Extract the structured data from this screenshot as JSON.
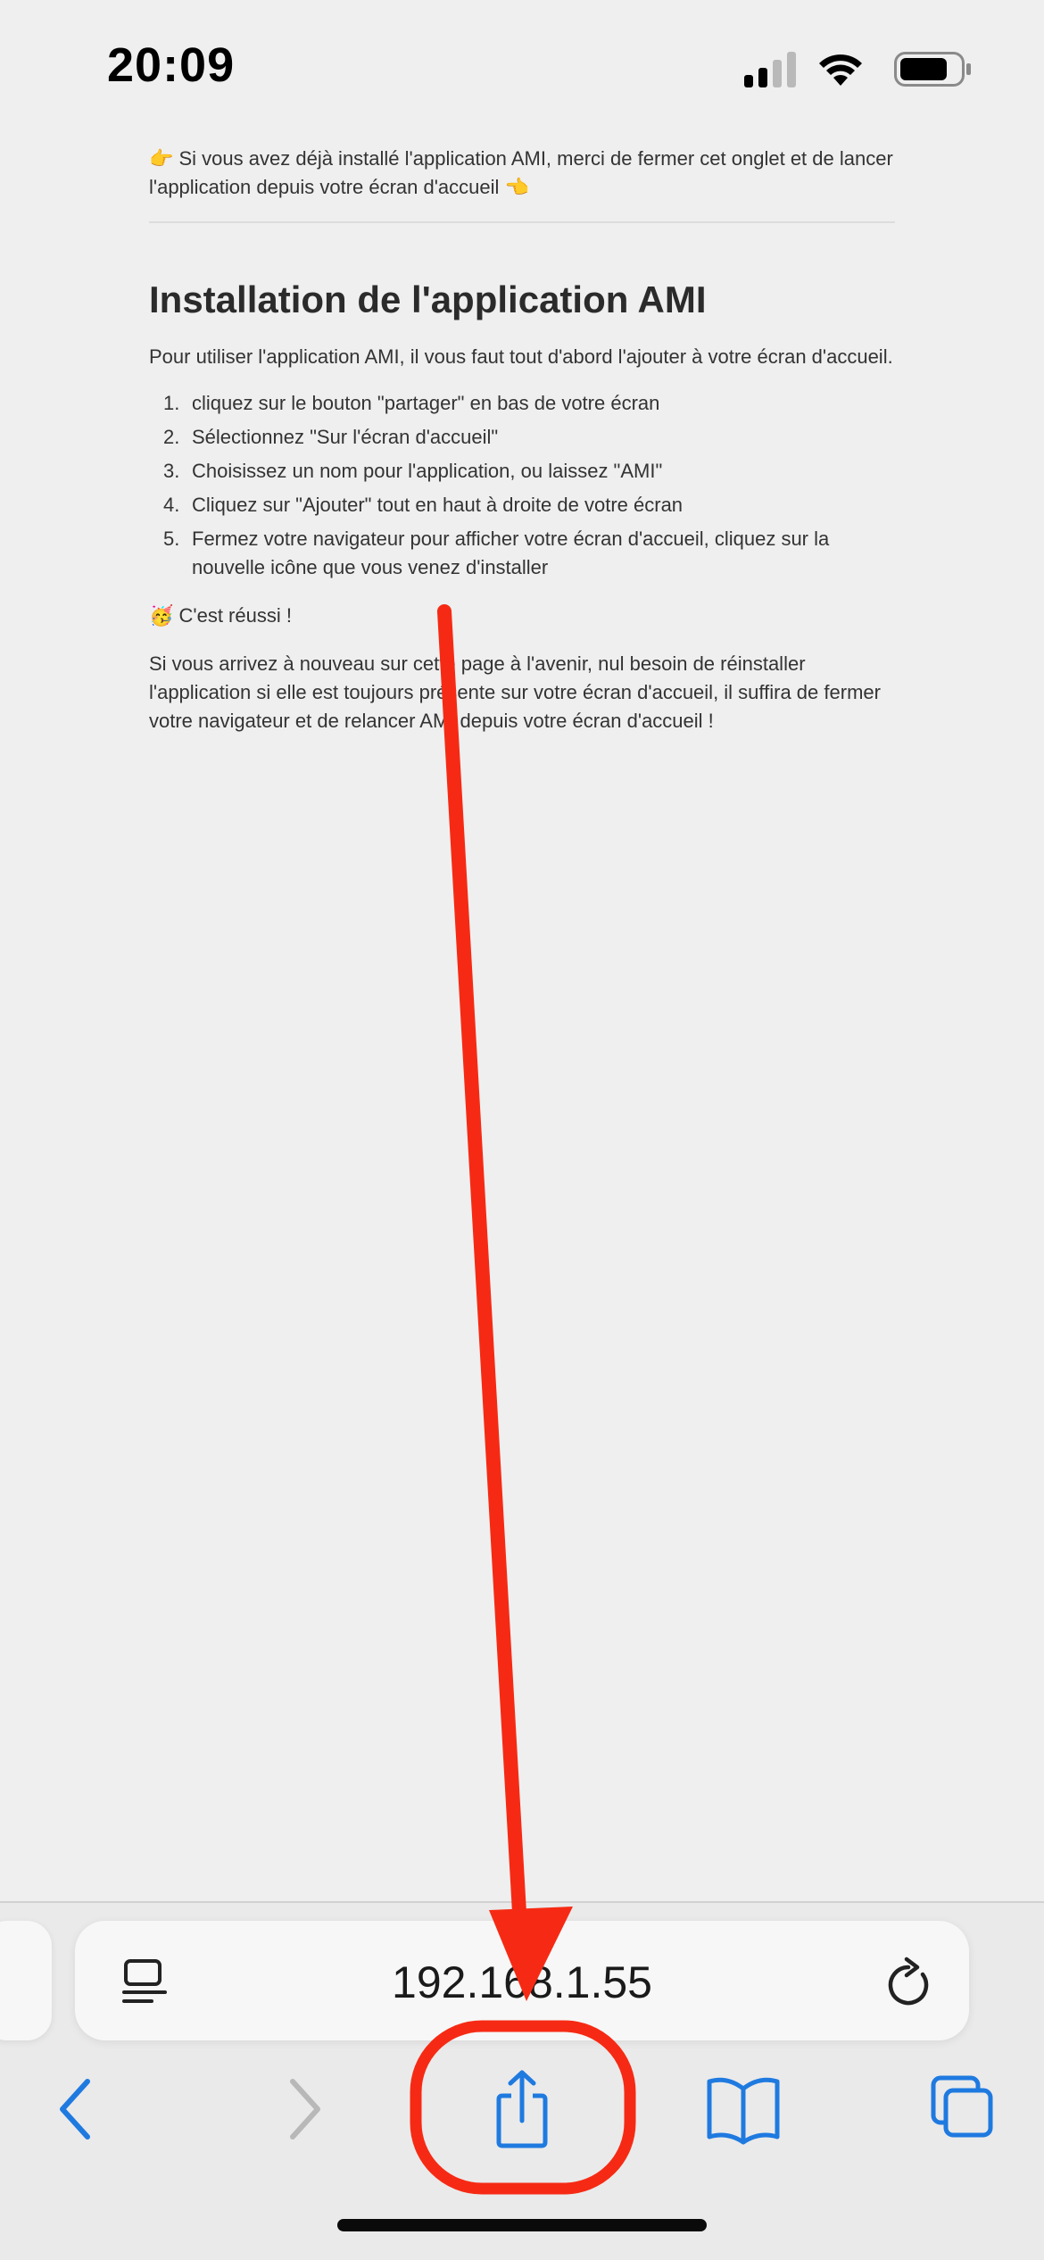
{
  "status_bar": {
    "time": "20:09"
  },
  "page": {
    "notice": "👉 Si vous avez déjà installé l'application AMI, merci de fermer cet onglet et de lancer l'application depuis votre écran d'accueil 👈",
    "title": "Installation de l'application AMI",
    "intro": "Pour utiliser l'application AMI, il vous faut tout d'abord l'ajouter à votre écran d'accueil.",
    "steps": [
      {
        "num": "1.",
        "text": "cliquez sur le bouton \"partager\" en bas de votre écran"
      },
      {
        "num": "2.",
        "text": "Sélectionnez \"Sur l'écran d'accueil\""
      },
      {
        "num": "3.",
        "text": "Choisissez un nom pour l'application, ou laissez \"AMI\""
      },
      {
        "num": "4.",
        "text": "Cliquez sur \"Ajouter\" tout en haut à droite de votre écran"
      },
      {
        "num": "5.",
        "text": "Fermez votre navigateur pour afficher votre écran d'accueil, cliquez sur la nouvelle icône que vous venez d'installer"
      }
    ],
    "success": "🥳 C'est réussi !",
    "outro": "Si vous arrivez à nouveau sur cette page à l'avenir, nul besoin de réinstaller l'application si elle est toujours présente sur votre écran d'accueil, il suffira de fermer votre navigateur et de relancer AMI depuis votre écran d'accueil !"
  },
  "address_bar": {
    "url": "192.168.1.55"
  },
  "toolbar": {
    "icons": [
      "back-icon",
      "forward-icon",
      "share-icon",
      "bookmarks-icon",
      "tabs-icon"
    ],
    "accent_color": "#1f7ae0",
    "disabled_color": "#b8b8b8"
  },
  "annotation": {
    "color": "#f62a14"
  }
}
